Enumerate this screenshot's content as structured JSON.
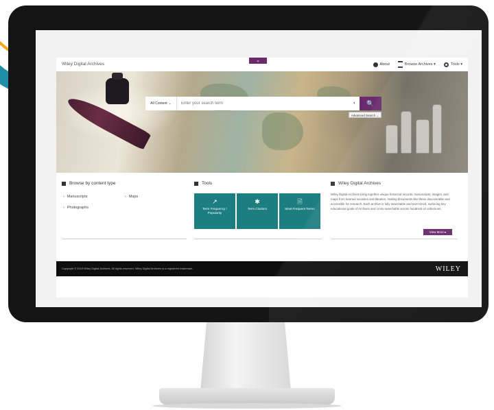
{
  "header": {
    "logo_text": "Wiley Digital Archives",
    "collapse_glyph": "⌄",
    "nav": [
      {
        "icon": "help-icon",
        "label": "About"
      },
      {
        "icon": "list-icon",
        "label": "Browse Archives ▾"
      },
      {
        "icon": "gear-icon",
        "label": "Tools ▾"
      }
    ]
  },
  "search": {
    "scope_label": "All Content",
    "scope_caret": "⌄",
    "placeholder": "Enter your search term",
    "mic_glyph": "◐",
    "button_glyph": "🔍",
    "advanced_label": "Advanced Search ⌄"
  },
  "browse": {
    "title": "Browse by content type",
    "items": [
      "Manuscripts",
      "Maps",
      "Photographs"
    ]
  },
  "tools": {
    "title": "Tools",
    "items": [
      {
        "icon": "trend-icon",
        "glyph": "↗",
        "label": "Term Frequency / Popularity"
      },
      {
        "icon": "cluster-icon",
        "glyph": "✱",
        "label": "Term Clusters"
      },
      {
        "icon": "document-icon",
        "glyph": "🗎",
        "label": "Most Frequent Terms"
      }
    ]
  },
  "about": {
    "title": "Wiley Digital Archives",
    "text": "Wiley Digital Archives bring together unique historical records, manuscripts, images, and maps from learned societies and libraries, making documents like these discoverable and accessible for research. Each archive is fully searchable and text-mined, surfacing key educational goals of Archives and cross-searchable across hundreds of collections.",
    "view_more": "View More ▸"
  },
  "footer": {
    "copyright": "Copyright © 2019 Wiley Digital Archives. All rights reserved. Wiley Digital Archives is a registered trademark.",
    "brand": "WILEY"
  },
  "colors": {
    "accent": "#6a2b6e",
    "teal": "#1d7e82",
    "footer": "#0e0e0e"
  }
}
